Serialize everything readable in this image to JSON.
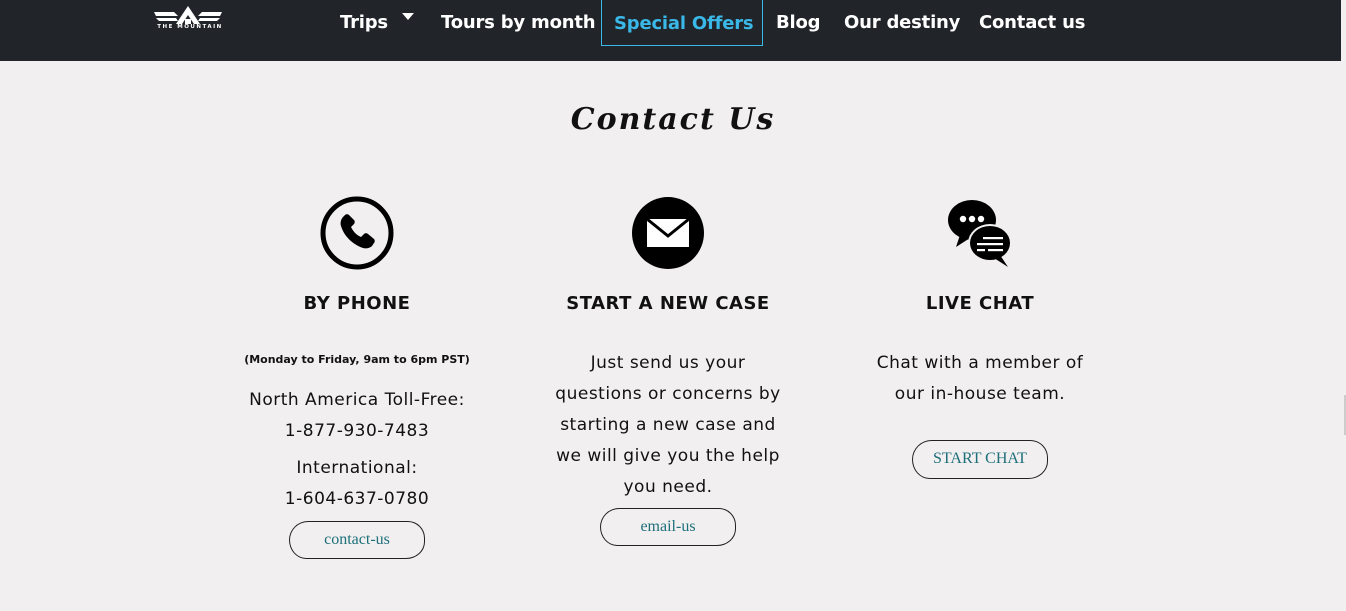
{
  "logo": {
    "name": "THE MOUNTAIN"
  },
  "nav": {
    "items": [
      "Trips",
      "Tours by month",
      "Special Offers",
      "Blog",
      "Our destiny",
      "Contact us"
    ],
    "active": "Special Offers"
  },
  "main": {
    "title": "Contact Us",
    "columns": [
      {
        "icon": "phone-icon",
        "heading": "BY PHONE",
        "note": "(Monday to Friday, 9am to 6pm PST)",
        "lines": [
          "North America Toll-Free:",
          "1-877-930-7483",
          "International:",
          "1-604-637-0780"
        ],
        "button": "contact-us"
      },
      {
        "icon": "envelope-icon",
        "heading": "START A NEW CASE",
        "lines": [
          "Just send us your",
          "questions or concerns by",
          "starting a new case and",
          "we will give you the help",
          "you need."
        ],
        "button": "email-us"
      },
      {
        "icon": "chat-bubbles-icon",
        "heading": "LIVE CHAT",
        "lines": [
          "Chat with a member of",
          "our in-house team."
        ],
        "button": "START CHAT"
      }
    ]
  },
  "colors": {
    "navbar_bg": "#212429",
    "active_nav": "#3ab8e8",
    "page_bg": "#f1efef",
    "button_text": "#1d6f7a"
  }
}
